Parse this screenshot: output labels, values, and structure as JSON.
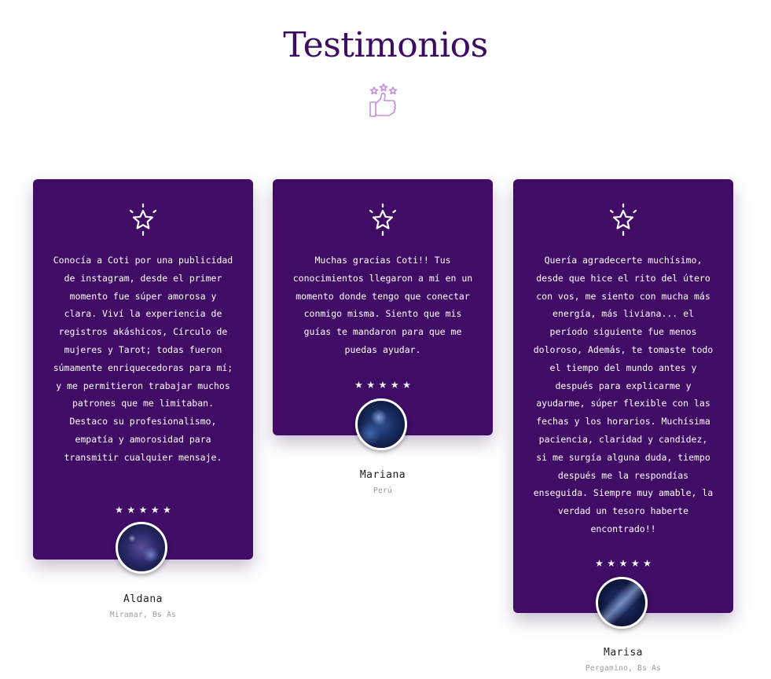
{
  "section": {
    "title": "Testimonios",
    "title_icon": "thumbs-up-stars-icon"
  },
  "colors": {
    "card_background": "#400c66",
    "title": "#3d0b63",
    "icon_accent": "#c78de0"
  },
  "testimonials": [
    {
      "icon": "star-outline-icon",
      "quote": "Conocía a Coti por una publicidad de instagram, desde el primer momento fue súper amorosa y clara. Viví la experiencia de registros akáshicos, Círculo de mujeres y Tarot; todas fueron súmamente enriquecedoras para mí; y me permitieron trabajar muchos patrones que me limitaban. Destaco su profesionalismo, empatía y amorosidad para transmitir cualquier mensaje.",
      "rating": 5,
      "stars": "★★★★★",
      "name": "Aldana",
      "location": "Miramar, Bs As"
    },
    {
      "icon": "star-outline-icon",
      "quote": "Muchas gracias Coti!! Tus conocimientos llegaron a mí en un momento donde tengo que conectar conmigo misma. Siento que mis guías te mandaron para que me puedas ayudar.",
      "rating": 5,
      "stars": "★★★★★",
      "name": "Mariana",
      "location": "Perú"
    },
    {
      "icon": "star-outline-icon",
      "quote": "Quería agradecerte muchísimo, desde que hice el rito del útero con vos, me siento con mucha más energía, más liviana... el período siguiente fue menos doloroso, Además, te tomaste todo el tiempo del mundo antes y después para explicarme y ayudarme, súper flexible con las fechas y los horarios. Muchísima paciencia, claridad y candidez, si me surgía alguna duda, tiempo después me la respondías enseguida. Siempre muy amable, la verdad un tesoro haberte encontrado!!",
      "rating": 5,
      "stars": "★★★★★",
      "name": "Marisa",
      "location": "Pergamino, Bs As"
    }
  ]
}
